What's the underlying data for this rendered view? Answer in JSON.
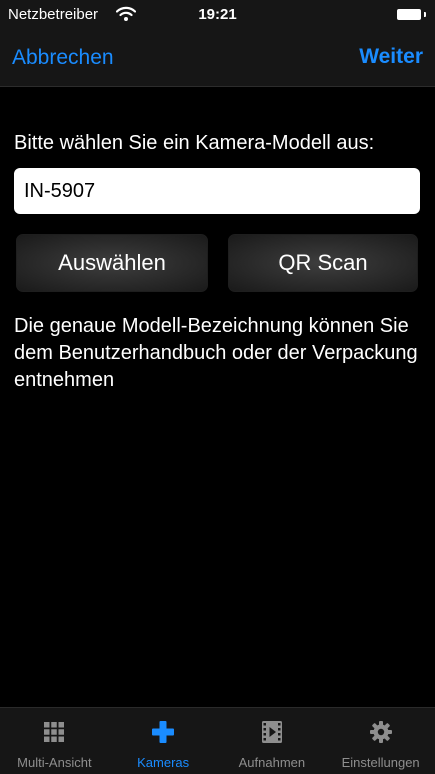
{
  "status_bar": {
    "carrier": "Netzbetreiber",
    "time": "19:21",
    "wifi_icon": "wifi-icon",
    "battery_icon": "battery-icon"
  },
  "nav": {
    "cancel_label": "Abbrechen",
    "next_label": "Weiter"
  },
  "main": {
    "prompt": "Bitte wählen Sie ein Kamera-Modell aus:",
    "model_input_value": "IN-5907",
    "select_button_label": "Auswählen",
    "qr_button_label": "QR Scan",
    "info_text": "Die genaue Modell-Bezeichnung können Sie dem Benutzerhandbuch oder der Verpackung entnehmen"
  },
  "tab_bar": {
    "items": [
      {
        "label": "Multi-Ansicht",
        "icon": "grid-icon",
        "active": false
      },
      {
        "label": "Kameras",
        "icon": "plus-icon",
        "active": true
      },
      {
        "label": "Aufnahmen",
        "icon": "film-icon",
        "active": false
      },
      {
        "label": "Einstellungen",
        "icon": "gear-icon",
        "active": false
      }
    ]
  },
  "colors": {
    "accent": "#1a8cff",
    "background": "#000000",
    "bar_background": "#161616",
    "inactive_tab": "#8e8e8e"
  }
}
